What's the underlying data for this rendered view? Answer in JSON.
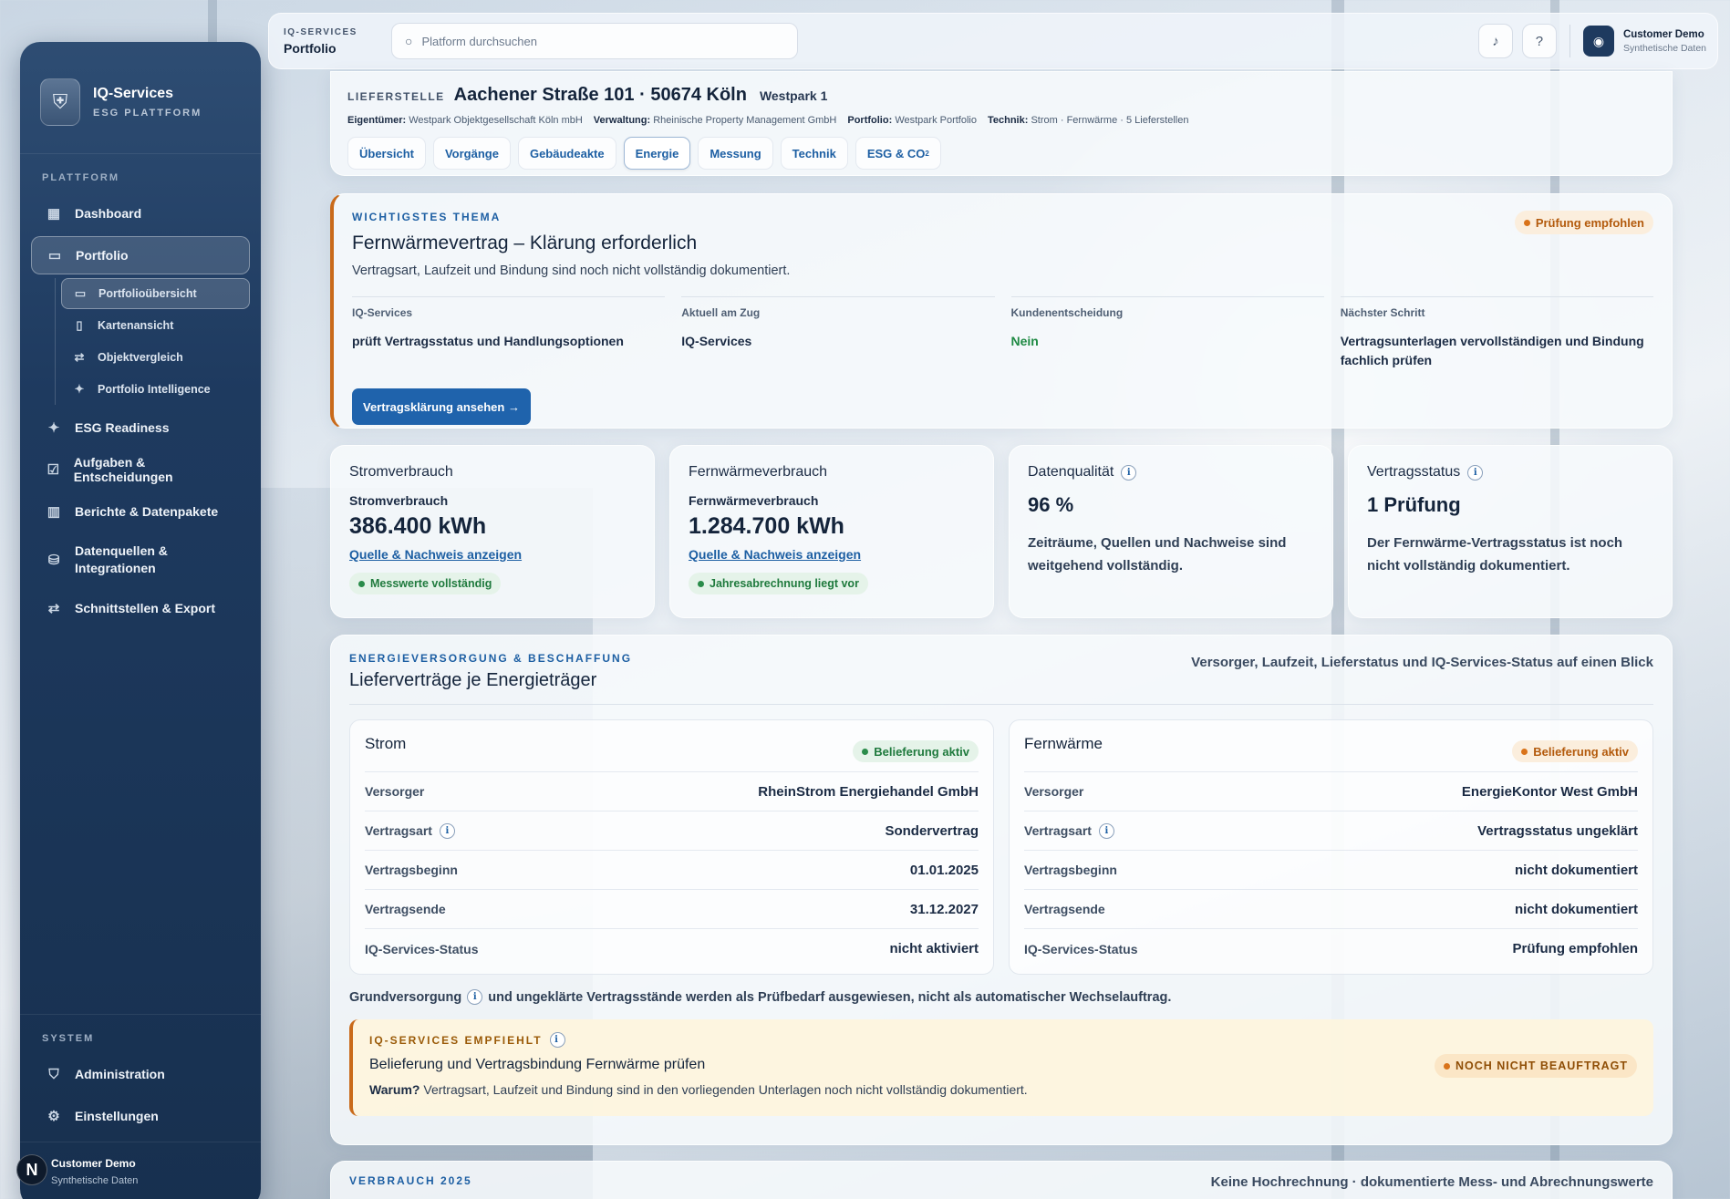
{
  "sidebar": {
    "brand_name": "IQ-Services",
    "brand_sub": "ESG PLATTFORM",
    "section_platform": "PLATTFORM",
    "items": [
      {
        "label": "Dashboard"
      },
      {
        "label": "Portfolio"
      },
      {
        "label": "ESG Readiness"
      },
      {
        "label": "Aufgaben & Entscheidungen"
      },
      {
        "label": "Berichte & Datenpakete"
      },
      {
        "label": "Datenquellen & Integrationen"
      },
      {
        "label": "Schnittstellen & Export"
      }
    ],
    "sub_items": [
      {
        "label": "Portfolioübersicht"
      },
      {
        "label": "Kartenansicht"
      },
      {
        "label": "Objektvergleich"
      },
      {
        "label": "Portfolio Intelligence"
      }
    ],
    "section_system": "SYSTEM",
    "system_items": [
      {
        "label": "Administration"
      },
      {
        "label": "Einstellungen"
      }
    ],
    "user_name": "Customer Demo",
    "user_sub": "Synthetische Daten",
    "badge_letter": "N"
  },
  "topbar": {
    "context_key": "IQ-SERVICES",
    "context_value": "Portfolio",
    "search_placeholder": "Platform durchsuchen",
    "user_name": "Customer Demo",
    "user_sub": "Synthetische Daten"
  },
  "lieferstelle": {
    "key": "LIEFERSTELLE",
    "title": "Aachener Straße 101 · 50674 Köln",
    "subtitle": "Westpark 1",
    "meta": [
      {
        "k": "Eigentümer:",
        "v": "Westpark Objektgesellschaft Köln mbH"
      },
      {
        "k": "Verwaltung:",
        "v": "Rheinische Property Management GmbH"
      },
      {
        "k": "Portfolio:",
        "v": "Westpark Portfolio"
      },
      {
        "k": "Technik:",
        "v": "Strom · Fernwärme · 5 Lieferstellen"
      }
    ],
    "tabs": [
      "Übersicht",
      "Vorgänge",
      "Gebäudeakte",
      "Energie",
      "Messung",
      "Technik",
      "ESG & CO"
    ],
    "tab_sub": "2"
  },
  "topic": {
    "eyebrow": "WICHTIGSTES THEMA",
    "title": "Fernwärmevertrag – Klärung erforderlich",
    "desc": "Vertragsart, Laufzeit und Bindung sind noch nicht vollständig dokumentiert.",
    "badge": "Prüfung empfohlen",
    "cells": [
      {
        "k": "IQ-Services",
        "v": "prüft Vertragsstatus und Handlungsoptionen"
      },
      {
        "k": "Aktuell am Zug",
        "v": "IQ-Services"
      },
      {
        "k": "Kundenentscheidung",
        "v": "Nein"
      },
      {
        "k": "Nächster Schritt",
        "v": "Vertragsunterlagen vervollständigen und Bindung fachlich prüfen"
      }
    ],
    "button": "Vertragsklärung ansehen →"
  },
  "kpis": [
    {
      "label": "Stromverbrauch",
      "sub": "Stromverbrauch",
      "value": "386.400 kWh",
      "link": "Quelle & Nachweis anzeigen",
      "badge": "Messwerte vollständig"
    },
    {
      "label": "Fernwärmeverbrauch",
      "sub": "Fernwärmeverbrauch",
      "value": "1.284.700 kWh",
      "link": "Quelle & Nachweis anzeigen",
      "badge": "Jahresabrechnung liegt vor"
    },
    {
      "label": "Datenqualität",
      "value": "96 %",
      "text": "Zeiträume, Quellen und Nachweise sind weitgehend vollständig."
    },
    {
      "label": "Vertragsstatus",
      "value": "1 Prüfung",
      "text": "Der Fernwärme-Vertragsstatus ist noch nicht vollständig dokumentiert."
    }
  ],
  "energy": {
    "eyebrow": "ENERGIEVERSORGUNG & BESCHAFFUNG",
    "title": "Lieferverträge je Energieträger",
    "head_right": "Versorger, Laufzeit, Lieferstatus und IQ-Services-Status auf einen Blick",
    "contracts": [
      {
        "name": "Strom",
        "badge": "Belieferung aktiv",
        "rows": [
          {
            "k": "Versorger",
            "v": "RheinStrom Energiehandel GmbH"
          },
          {
            "k": "Vertragsart",
            "v": "Sondervertrag"
          },
          {
            "k": "Vertragsbeginn",
            "v": "01.01.2025"
          },
          {
            "k": "Vertragsende",
            "v": "31.12.2027"
          },
          {
            "k": "IQ-Services-Status",
            "v": "nicht aktiviert"
          }
        ]
      },
      {
        "name": "Fernwärme",
        "badge": "Belieferung aktiv",
        "rows": [
          {
            "k": "Versorger",
            "v": "EnergieKontor West GmbH"
          },
          {
            "k": "Vertragsart",
            "v": "Vertragsstatus ungeklärt"
          },
          {
            "k": "Vertragsbeginn",
            "v": "nicht dokumentiert"
          },
          {
            "k": "Vertragsende",
            "v": "nicht dokumentiert"
          },
          {
            "k": "IQ-Services-Status",
            "v": "Prüfung empfohlen"
          }
        ]
      }
    ],
    "note_a": "Grundversorgung",
    "note_b": "und ungeklärte Vertragsstände werden als Prüfbedarf ausgewiesen, nicht als automatischer Wechselauftrag.",
    "reco": {
      "eyebrow": "IQ-SERVICES EMPFIEHLT",
      "title": "Belieferung und Vertragsbindung Fernwärme prüfen",
      "why_k": "Warum?",
      "why_v": "Vertragsart, Laufzeit und Bindung sind in den vorliegenden Unterlagen noch nicht vollständig dokumentiert.",
      "badge": "NOCH NICHT BEAUFTRAGT"
    }
  },
  "verbrauch": {
    "eyebrow": "VERBRAUCH 2025",
    "right": "Keine Hochrechnung · dokumentierte Mess- und Abrechnungswerte"
  }
}
